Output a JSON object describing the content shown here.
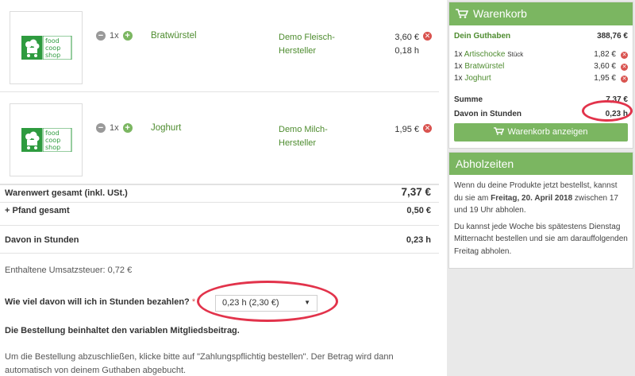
{
  "products": [
    {
      "name": "Bratwürstel",
      "qty": "1x",
      "maker": "Demo Fleisch-\nHersteller",
      "price": "3,60 €",
      "hours": "0,18 h",
      "logo": [
        "food",
        "coop",
        "shop"
      ]
    },
    {
      "name": "Joghurt",
      "qty": "1x",
      "maker": "Demo Milch-\nHersteller",
      "price": "1,95 €",
      "hours": "",
      "logo": [
        "food",
        "coop",
        "shop"
      ]
    }
  ],
  "totals": {
    "warenwert_label": "Warenwert gesamt (inkl. USt.)",
    "warenwert": "7,37 €",
    "pfand_label": "+ Pfand gesamt",
    "pfand": "0,50 €",
    "stunden_label": "Davon in Stunden",
    "stunden": "0,23 h",
    "ust_text": "Enthaltene Umsatzsteuer: 0,72 €"
  },
  "question": {
    "label": "Wie viel davon will ich in Stunden bezahlen?",
    "required_mark": "*",
    "selected": "0,23 h (2,30 €)"
  },
  "notes": {
    "bold": "Die Bestellung beinhaltet den variablen Mitgliedsbeitrag.",
    "text": "Um die Bestellung abzuschließen, klicke bitte auf \"Zahlungspflichtig bestellen\". Der Betrag wird dann automatisch von deinem Guthaben abgebucht."
  },
  "warenkorb": {
    "title": "Warenkorb",
    "guthaben_label": "Dein Guthaben",
    "guthaben": "388,76 €",
    "items": [
      {
        "qty": "1x",
        "name": "Artischocke",
        "unit": "Stück",
        "price": "1,82 €"
      },
      {
        "qty": "1x",
        "name": "Bratwürstel",
        "unit": "",
        "price": "3,60 €"
      },
      {
        "qty": "1x",
        "name": "Joghurt",
        "unit": "",
        "price": "1,95 €"
      }
    ],
    "summe_label": "Summe",
    "summe": "7,37 €",
    "stunden_label": "Davon in Stunden",
    "stunden": "0,23 h",
    "button": "Warenkorb anzeigen"
  },
  "abholzeiten": {
    "title": "Abholzeiten",
    "p1_pre": "Wenn du deine Produkte jetzt bestellst, kannst du sie am ",
    "p1_bold": "Freitag, 20. April 2018",
    "p1_post": " zwischen 17 und 19 Uhr abholen.",
    "p2": "Du kannst jede Woche bis spätestens Dienstag Mitternacht bestellen und sie am darauffolgenden Freitag abholen."
  },
  "colors": {
    "accent": "#7bb661",
    "link": "#4e8c2f",
    "danger": "#d9534f",
    "highlight": "#e2334b"
  }
}
